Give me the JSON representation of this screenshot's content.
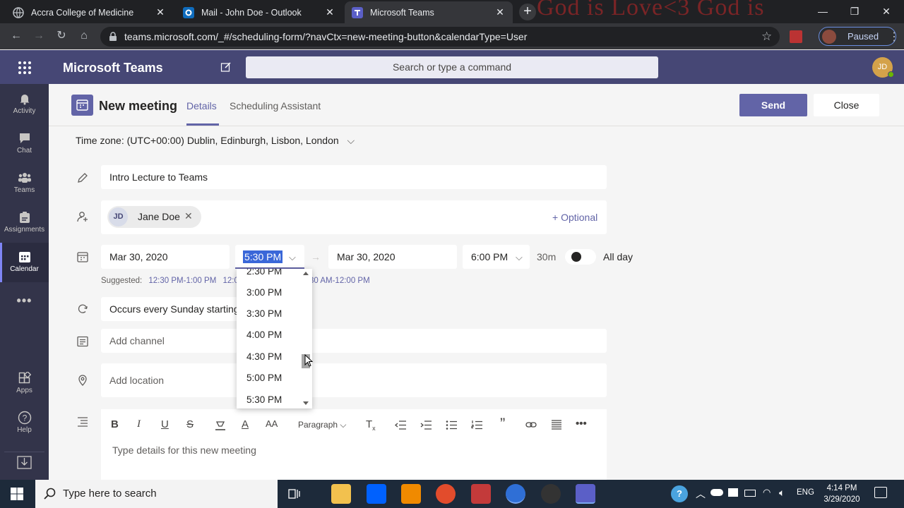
{
  "browser": {
    "tabs": [
      {
        "title": "Accra College of Medicine",
        "icon": "globe-icon"
      },
      {
        "title": "Mail - John Doe - Outlook",
        "icon": "outlook-icon"
      },
      {
        "title": "Microsoft Teams",
        "icon": "teams-icon"
      }
    ],
    "decor_text": "God is Love<3 God is",
    "url": "teams.microsoft.com/_#/scheduling-form/?navCtx=new-meeting-button&calendarType=User",
    "profile_status": "Paused"
  },
  "teams": {
    "app_name": "Microsoft Teams",
    "search_placeholder": "Search or type a command",
    "user_initials": "JD",
    "rail": [
      {
        "label": "Activity",
        "icon": "bell-icon"
      },
      {
        "label": "Chat",
        "icon": "chat-icon"
      },
      {
        "label": "Teams",
        "icon": "teams-icon"
      },
      {
        "label": "Assignments",
        "icon": "assignments-icon"
      },
      {
        "label": "Calendar",
        "icon": "calendar-icon",
        "selected": true
      },
      {
        "label": "",
        "icon": "more-icon"
      },
      {
        "label": "Apps",
        "icon": "apps-icon"
      },
      {
        "label": "Help",
        "icon": "help-icon"
      }
    ]
  },
  "meeting": {
    "page_title": "New meeting",
    "tab_details": "Details",
    "tab_scheduling": "Scheduling Assistant",
    "send_label": "Send",
    "close_label": "Close",
    "timezone": "Time zone: (UTC+00:00) Dublin, Edinburgh, Lisbon, London",
    "title_value": "Intro Lecture to Teams",
    "attendee": {
      "initials": "JD",
      "name": "Jane Doe"
    },
    "optional_label": "+ Optional",
    "start_date": "Mar 30, 2020",
    "start_time": "5:30 PM",
    "end_date": "Mar 30, 2020",
    "end_time": "6:00 PM",
    "duration": "30m",
    "all_day_label": "All day",
    "all_day_on": false,
    "suggested_label": "Suggested:",
    "suggested_slots": [
      "12:30 PM-1:00 PM",
      "12:0"
    ],
    "suggested_slot_3": "30 AM-12:00 PM",
    "recurrence": "Occurs every Sunday starting",
    "channel_placeholder": "Add channel",
    "location_placeholder": "Add location",
    "paragraph_label": "Paragraph",
    "details_placeholder": "Type details for this new meeting",
    "time_options": [
      "2:30 PM",
      "3:00 PM",
      "3:30 PM",
      "4:00 PM",
      "4:30 PM",
      "5:00 PM",
      "5:30 PM"
    ]
  },
  "taskbar": {
    "search_placeholder": "Type here to search",
    "language": "ENG",
    "time": "4:14 PM",
    "date": "3/29/2020"
  }
}
